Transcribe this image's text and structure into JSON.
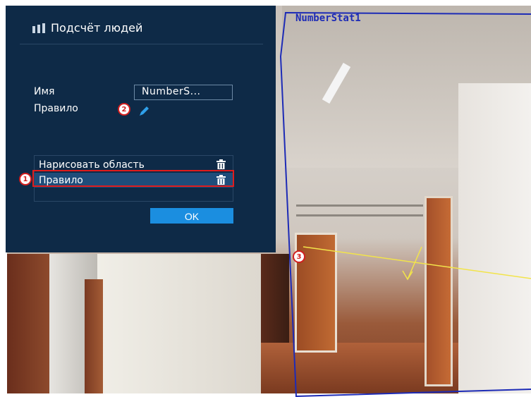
{
  "dialog": {
    "title": "Подсчёт людей",
    "name_label": "Имя",
    "name_value": "NumberS...",
    "rule_label": "Правило",
    "list": [
      {
        "label": "Нарисовать область"
      },
      {
        "label": "Правило"
      }
    ],
    "ok_label": "OK"
  },
  "video": {
    "zone_name": "NumberStat1"
  },
  "callouts": {
    "one": "1",
    "two": "2",
    "three": "3"
  },
  "colors": {
    "dialog_bg": "#0e2a47",
    "accent": "#1b8ee0",
    "zone_line": "#1d2bb6",
    "rule_line": "#f2e44a",
    "callout": "#e01c1c"
  }
}
